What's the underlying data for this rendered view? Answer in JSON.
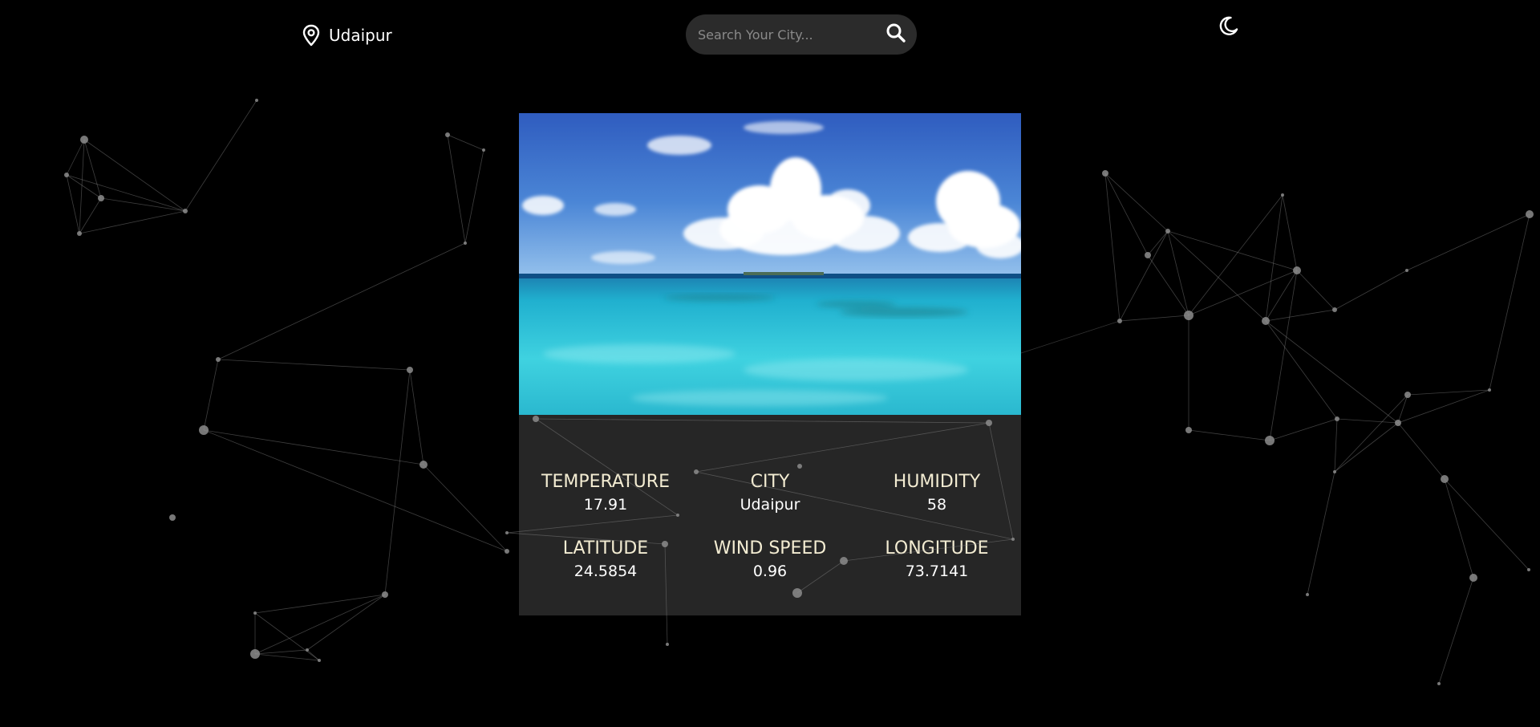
{
  "header": {
    "location": "Udaipur",
    "search": {
      "placeholder": "Search Your City..."
    }
  },
  "icons": {
    "location": "map-pin-icon",
    "search": "magnifier-icon",
    "theme": "crescent-moon-icon"
  },
  "colors": {
    "background": "#000000",
    "card": "#262626",
    "search_bg": "#2b2b2b",
    "label": "#f3ecd2",
    "value": "#ffffff",
    "particles": "#8c8c8c"
  },
  "weather": {
    "temperature": {
      "label": "TEMPERATURE",
      "value": "17.91"
    },
    "city": {
      "label": "CITY",
      "value": "Udaipur"
    },
    "humidity": {
      "label": "HUMIDITY",
      "value": "58"
    },
    "latitude": {
      "label": "LATITUDE",
      "value": "24.5854"
    },
    "wind_speed": {
      "label": "WIND SPEED",
      "value": "0.96"
    },
    "longitude": {
      "label": "LONGITUDE",
      "value": "73.7141"
    }
  }
}
